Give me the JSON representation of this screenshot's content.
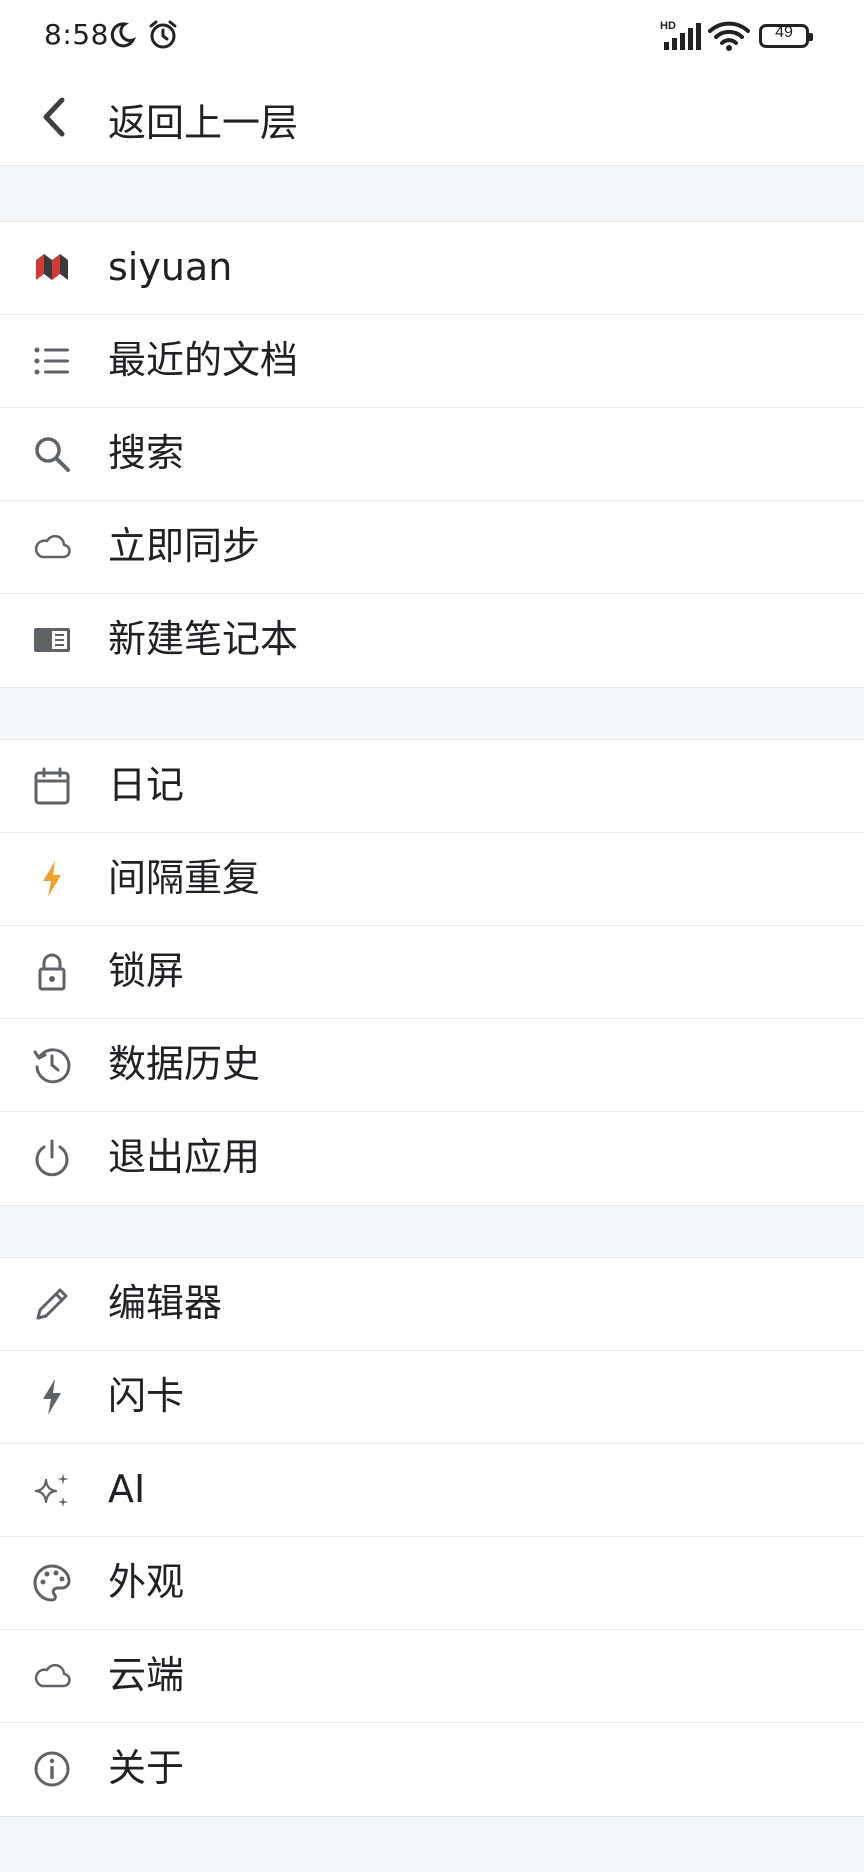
{
  "status_bar": {
    "time": "8:58",
    "battery": "49",
    "network_label": "HD"
  },
  "header": {
    "back_label": "返回上一层"
  },
  "sections": [
    {
      "items": [
        {
          "label": "siyuan",
          "icon": "siyuan-logo-icon"
        },
        {
          "label": "最近的文档",
          "icon": "list-icon"
        },
        {
          "label": "搜索",
          "icon": "search-icon"
        },
        {
          "label": "立即同步",
          "icon": "cloud-icon"
        },
        {
          "label": "新建笔记本",
          "icon": "notebook-icon"
        }
      ]
    },
    {
      "items": [
        {
          "label": "日记",
          "icon": "calendar-icon"
        },
        {
          "label": "间隔重复",
          "icon": "lightning-icon"
        },
        {
          "label": "锁屏",
          "icon": "lock-icon"
        },
        {
          "label": "数据历史",
          "icon": "history-icon"
        },
        {
          "label": "退出应用",
          "icon": "power-icon"
        }
      ]
    },
    {
      "items": [
        {
          "label": "编辑器",
          "icon": "pencil-icon"
        },
        {
          "label": "闪卡",
          "icon": "flash-icon"
        },
        {
          "label": "AI",
          "icon": "sparkle-icon"
        },
        {
          "label": "外观",
          "icon": "palette-icon"
        },
        {
          "label": "云端",
          "icon": "cloud-outline-icon"
        },
        {
          "label": "关于",
          "icon": "info-icon"
        }
      ]
    }
  ],
  "colors": {
    "accent_lightning": "#f0a22e",
    "logo_red": "#d23a34",
    "logo_dark": "#3a3a3a",
    "icon_gray": "#5f6368"
  }
}
